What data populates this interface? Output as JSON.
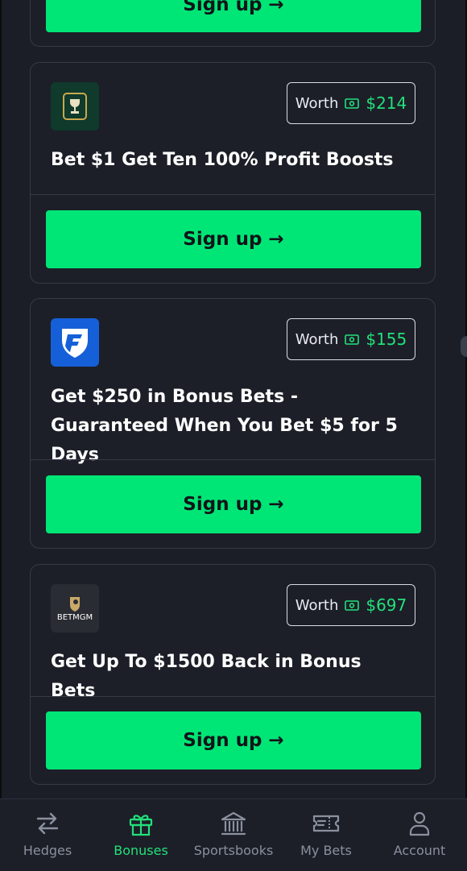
{
  "offers": [
    {
      "worth_label": "Worth",
      "worth_amount": "$214",
      "title": "Bet $1 Get Ten 100% Profit Boosts",
      "button_label": "Sign up →",
      "logo": "trophy-logo"
    },
    {
      "worth_label": "Worth",
      "worth_amount": "$155",
      "title": "Get $250 in Bonus Bets - Guaranteed When You Bet $5 for 5 Days",
      "button_label": "Sign up →",
      "logo": "fanduel-shield-logo"
    },
    {
      "worth_label": "Worth",
      "worth_amount": "$697",
      "title": "Get Up To $1500 Back in Bonus Bets",
      "button_label": "Sign up →",
      "logo": "betmgm-logo",
      "logo_text": "BETMGM"
    }
  ],
  "partial_button_label": "Sign up →",
  "nav": [
    {
      "label": "Hedges",
      "icon": "arrows-swap-icon",
      "active": false
    },
    {
      "label": "Bonuses",
      "icon": "gift-icon",
      "active": true
    },
    {
      "label": "Sportsbooks",
      "icon": "bank-icon",
      "active": false
    },
    {
      "label": "My Bets",
      "icon": "ticket-icon",
      "active": false
    },
    {
      "label": "Account",
      "icon": "user-icon",
      "active": false
    }
  ],
  "colors": {
    "accent": "#00e676",
    "accent_text": "#22e07a",
    "background": "#1b1e27",
    "border": "#343a47"
  }
}
